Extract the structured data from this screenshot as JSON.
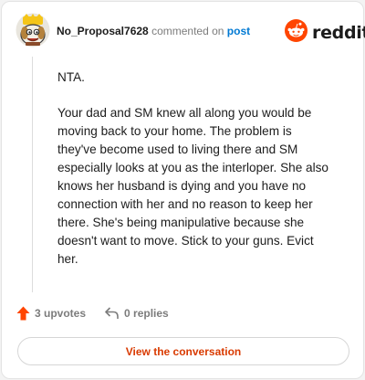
{
  "header": {
    "username": "No_Proposal7628",
    "action_text": "commented on",
    "post_label": "post",
    "brand": "reddit"
  },
  "comment": {
    "paragraphs": [
      "NTA.",
      "Your dad and SM knew all along you would be moving back to your home. The problem is they've become used to living there and SM especially looks at you as the interloper. She also knows her husband is dying and you have no connection with her and no reason to keep her there. She's being manipulative because she doesn't want to move. Stick to your guns. Evict her."
    ]
  },
  "actions": {
    "upvotes": "3 upvotes",
    "replies": "0 replies"
  },
  "cta": {
    "label": "View the conversation"
  },
  "icons": {
    "avatar": "snoo-avatar-icon",
    "logo": "reddit-snoo-icon",
    "upvote": "upvote-arrow-icon",
    "reply": "reply-arrow-icon"
  },
  "colors": {
    "brand_orange": "#ff4500",
    "link_blue": "#0079d3",
    "cta_text": "#d93a00",
    "upvote_active": "#ff4500"
  }
}
